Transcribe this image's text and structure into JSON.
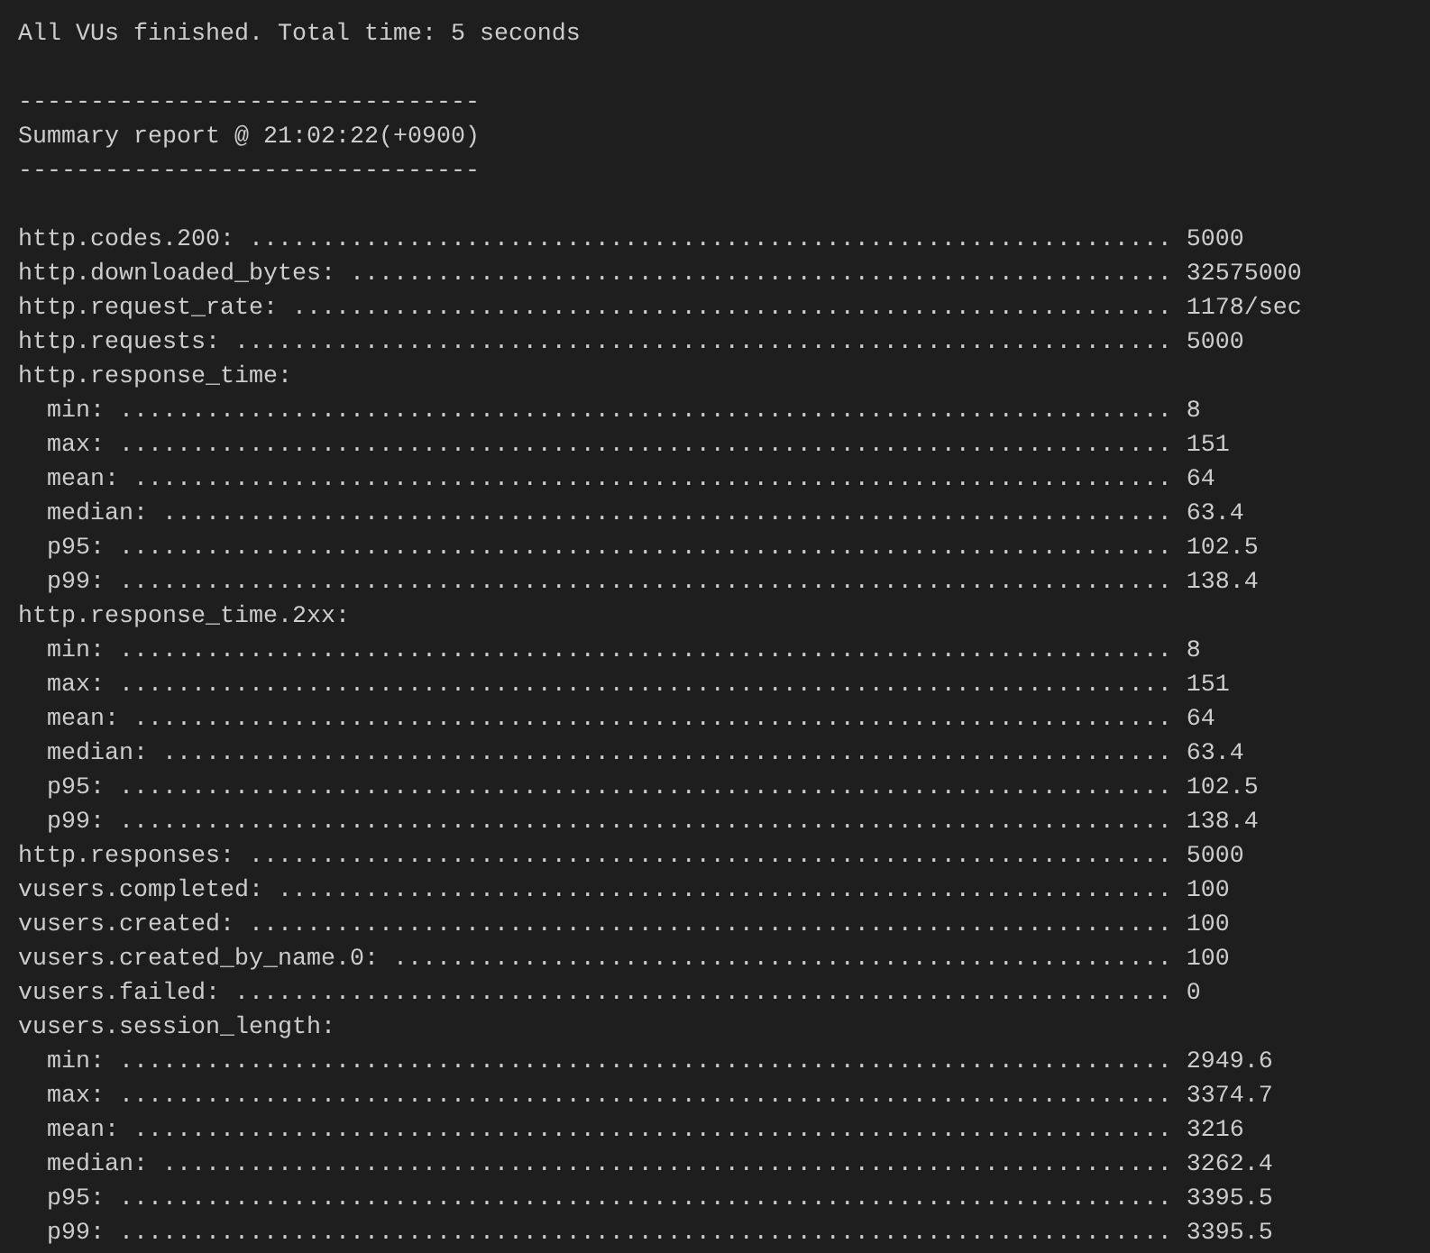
{
  "blocks": [
    {
      "lines": [
        "All VUs finished. Total time: 5 seconds"
      ]
    },
    {
      "lines": [
        "--------------------------------",
        "Summary report @ 21:02:22(+0900)",
        "--------------------------------"
      ]
    },
    {
      "lines": [
        "http.codes.200: ................................................................ 5000",
        "http.downloaded_bytes: ......................................................... 32575000",
        "http.request_rate: ............................................................. 1178/sec",
        "http.requests: ................................................................. 5000",
        "http.response_time:",
        "  min: ......................................................................... 8",
        "  max: ......................................................................... 151",
        "  mean: ........................................................................ 64",
        "  median: ...................................................................... 63.4",
        "  p95: ......................................................................... 102.5",
        "  p99: ......................................................................... 138.4",
        "http.response_time.2xx:",
        "  min: ......................................................................... 8",
        "  max: ......................................................................... 151",
        "  mean: ........................................................................ 64",
        "  median: ...................................................................... 63.4",
        "  p95: ......................................................................... 102.5",
        "  p99: ......................................................................... 138.4",
        "http.responses: ................................................................ 5000",
        "vusers.completed: .............................................................. 100",
        "vusers.created: ................................................................ 100",
        "vusers.created_by_name.0: ...................................................... 100",
        "vusers.failed: ................................................................. 0",
        "vusers.session_length:",
        "  min: ......................................................................... 2949.6",
        "  max: ......................................................................... 3374.7",
        "  mean: ........................................................................ 3216",
        "  median: ...................................................................... 3262.4",
        "  p95: ......................................................................... 3395.5",
        "  p99: ......................................................................... 3395.5"
      ]
    }
  ]
}
